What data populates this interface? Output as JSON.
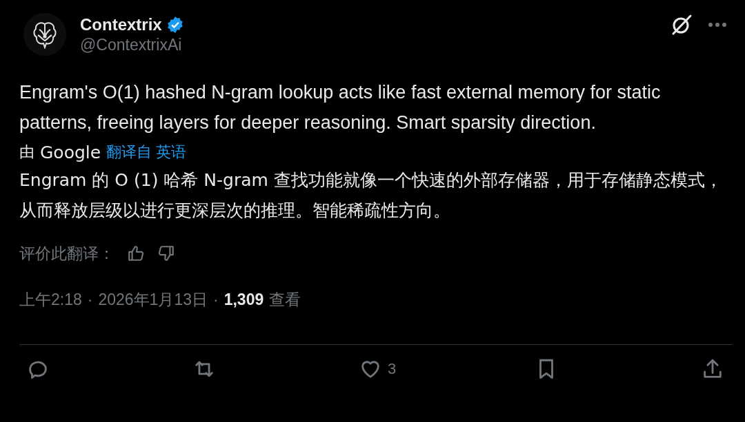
{
  "author": {
    "name": "Contextrix",
    "verified": true,
    "handle": "@ContextrixAi"
  },
  "post": {
    "text": "Engram's O(1) hashed N-gram lookup acts like fast external memory for static patterns, freeing layers for deeper reasoning. Smart sparsity direction."
  },
  "translation": {
    "by": "由",
    "provider": "Google",
    "link": "翻译自 英语",
    "text": "Engram 的 O (1) 哈希 N-gram 查找功能就像一个快速的外部存储器，用于存储静态模式，从而释放层级以进行更深层次的推理。智能稀疏性方向。",
    "rate_label": "评价此翻译："
  },
  "meta": {
    "time": "上午2:18",
    "separator": "·",
    "date": "2026年1月13日",
    "views": "1,309",
    "views_label": "查看"
  },
  "actions": [
    {
      "kind": "reply"
    },
    {
      "kind": "repost"
    },
    {
      "kind": "like",
      "count": "3"
    },
    {
      "kind": "bookmark"
    },
    {
      "kind": "share"
    }
  ]
}
